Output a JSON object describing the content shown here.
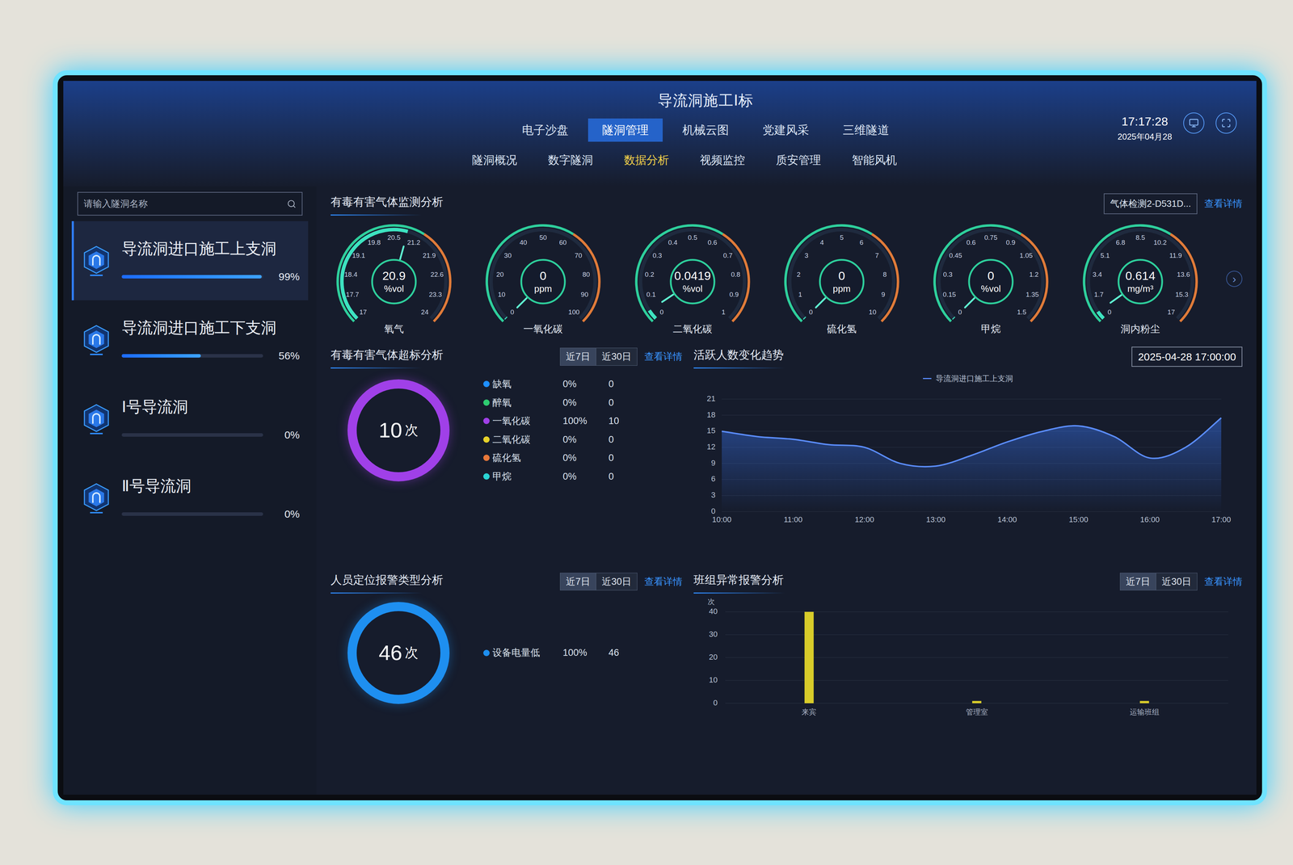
{
  "header": {
    "title": "导流洞施工Ⅰ标",
    "time": "17:17:28",
    "date": "2025年04月28",
    "nav": [
      {
        "label": "电子沙盘",
        "selected": false
      },
      {
        "label": "隧洞管理",
        "selected": true
      },
      {
        "label": "机械云图",
        "selected": false
      },
      {
        "label": "党建风采",
        "selected": false
      },
      {
        "label": "三维隧道",
        "selected": false
      }
    ],
    "subnav": [
      {
        "label": "隧洞概况",
        "selected": false
      },
      {
        "label": "数字隧洞",
        "selected": false
      },
      {
        "label": "数据分析",
        "selected": true
      },
      {
        "label": "视频监控",
        "selected": false
      },
      {
        "label": "质安管理",
        "selected": false
      },
      {
        "label": "智能风机",
        "selected": false
      }
    ]
  },
  "sidebar": {
    "search": {
      "placeholder": "请输入隧洞名称"
    },
    "items": [
      {
        "name": "导流洞进口施工上支洞",
        "percent": "99%",
        "level": 0.99,
        "selected": true
      },
      {
        "name": "导流洞进口施工下支洞",
        "percent": "56%",
        "level": 0.56,
        "selected": false
      },
      {
        "name": "Ⅰ号导流洞",
        "percent": "0%",
        "level": 0,
        "selected": false
      },
      {
        "name": "Ⅱ号导流洞",
        "percent": "0%",
        "level": 0,
        "selected": false
      }
    ]
  },
  "gas_monitor": {
    "title": "有毒有害气体监测分析",
    "device": "气体检测2-D531D...",
    "link": "查看详情",
    "next": "›",
    "gauges": [
      {
        "label": "氧气",
        "value": "20.9",
        "unit": "%vol",
        "level": 0.557,
        "ticks": [
          "17",
          "17.7",
          "18.4",
          "19.1",
          "19.8",
          "20.5",
          "21.2",
          "21.9",
          "22.6",
          "23.3",
          "24"
        ]
      },
      {
        "label": "一氧化碳",
        "value": "0",
        "unit": "ppm",
        "level": 0,
        "ticks": [
          "0",
          "10",
          "20",
          "30",
          "40",
          "50",
          "60",
          "70",
          "80",
          "90",
          "100"
        ]
      },
      {
        "label": "二氧化碳",
        "value": "0.0419",
        "unit": "%vol",
        "level": 0.042,
        "ticks": [
          "0",
          "0.1",
          "0.2",
          "0.3",
          "0.4",
          "0.5",
          "0.6",
          "0.7",
          "0.8",
          "0.9",
          "1"
        ]
      },
      {
        "label": "硫化氢",
        "value": "0",
        "unit": "ppm",
        "level": 0,
        "ticks": [
          "0",
          "1",
          "2",
          "3",
          "4",
          "5",
          "6",
          "7",
          "8",
          "9",
          "10"
        ]
      },
      {
        "label": "甲烷",
        "value": "0",
        "unit": "%vol",
        "level": 0,
        "ticks": [
          "0",
          "0.15",
          "0.3",
          "0.45",
          "0.6",
          "0.75",
          "0.9",
          "1.05",
          "1.2",
          "1.35",
          "1.5"
        ]
      },
      {
        "label": "洞内粉尘",
        "value": "0.614",
        "unit": "mg/m³",
        "level": 0.036,
        "ticks": [
          "0",
          "1.7",
          "3.4",
          "5.1",
          "6.8",
          "8.5",
          "10.2",
          "11.9",
          "13.6",
          "15.3",
          "17"
        ]
      }
    ]
  },
  "gas_exceed": {
    "title": "有毒有害气体超标分析",
    "ranges": [
      {
        "label": "近7日",
        "selected": true
      },
      {
        "label": "近30日",
        "selected": false
      }
    ],
    "link": "查看详情",
    "total": "10",
    "unit": "次",
    "color": "#a040e8",
    "legend": [
      {
        "name": "缺氧",
        "percent": "0%",
        "count": "0",
        "color": "#1e8fff"
      },
      {
        "name": "醉氧",
        "percent": "0%",
        "count": "0",
        "color": "#2ecc71"
      },
      {
        "name": "一氧化碳",
        "percent": "100%",
        "count": "10",
        "color": "#a040e8"
      },
      {
        "name": "二氧化碳",
        "percent": "0%",
        "count": "0",
        "color": "#e6d12a"
      },
      {
        "name": "硫化氢",
        "percent": "0%",
        "count": "0",
        "color": "#e8783a"
      },
      {
        "name": "甲烷",
        "percent": "0%",
        "count": "0",
        "color": "#2ad4d4"
      }
    ]
  },
  "active_trend": {
    "title": "活跃人数变化趋势",
    "datetime": "2025-04-28 17:00:00",
    "series": {
      "name": "导流洞进口施工上支洞",
      "values": [
        15,
        14,
        13.5,
        12.5,
        12,
        9,
        8.5,
        10.5,
        13,
        15,
        16,
        14,
        10,
        12,
        17.5
      ]
    },
    "y_ticks": [
      "0",
      "3",
      "6",
      "9",
      "12",
      "15",
      "18",
      "21"
    ],
    "x_ticks": [
      "10:00",
      "11:00",
      "12:00",
      "13:00",
      "14:00",
      "15:00",
      "16:00",
      "17:00"
    ]
  },
  "location_alarm": {
    "title": "人员定位报警类型分析",
    "ranges": [
      {
        "label": "近7日",
        "selected": true
      },
      {
        "label": "近30日",
        "selected": false
      }
    ],
    "link": "查看详情",
    "total": "46",
    "unit": "次",
    "color": "#1e8ff0",
    "legend": [
      {
        "name": "设备电量低",
        "percent": "100%",
        "count": "46",
        "color": "#1e8ff0"
      }
    ]
  },
  "team_alarm": {
    "title": "班组异常报警分析",
    "ranges": [
      {
        "label": "近7日",
        "selected": true
      },
      {
        "label": "近30日",
        "selected": false
      }
    ],
    "link": "查看详情",
    "y_unit": "次",
    "y_ticks": [
      "0",
      "10",
      "20",
      "30",
      "40"
    ],
    "bars": [
      {
        "label": "来宾",
        "value": 40
      },
      {
        "label": "管理室",
        "value": 1
      },
      {
        "label": "运输班组",
        "value": 1
      }
    ]
  }
}
